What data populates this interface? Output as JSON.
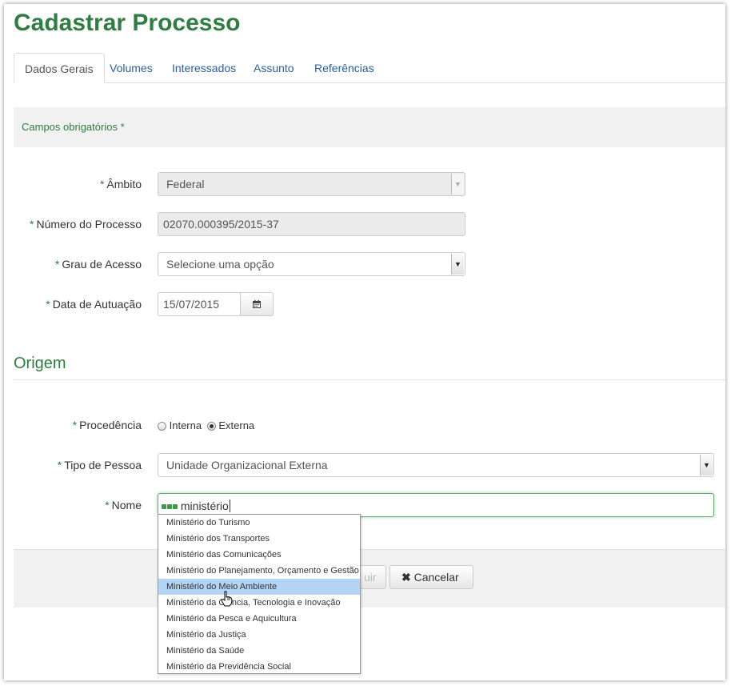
{
  "page_title": "Cadastrar Processo",
  "tabs": [
    {
      "label": "Dados Gerais"
    },
    {
      "label": "Volumes"
    },
    {
      "label": "Interessados"
    },
    {
      "label": "Assunto"
    },
    {
      "label": "Referências"
    }
  ],
  "required_note": "Campos obrigatórios",
  "required_mark": "*",
  "form": {
    "ambito": {
      "label": "Âmbito",
      "value": "Federal"
    },
    "numero": {
      "label": "Número do Processo",
      "value": "02070.000395/2015-37"
    },
    "grau": {
      "label": "Grau de Acesso",
      "value": "Selecione uma opção"
    },
    "data": {
      "label": "Data de Autuação",
      "value": "15/07/2015"
    }
  },
  "origem": {
    "title": "Origem",
    "procedencia": {
      "label": "Procedência",
      "option1": "Interna",
      "option2": "Externa",
      "selected": "Externa"
    },
    "tipo": {
      "label": "Tipo de Pessoa",
      "value": "Unidade Organizacional Externa"
    },
    "nome": {
      "label": "Nome",
      "value": "ministério"
    }
  },
  "buttons": {
    "incluir_partial": "uir",
    "cancelar": "Cancelar"
  },
  "autocomplete": [
    "Ministério do Turismo",
    "Ministério dos Transportes",
    "Ministério das Comunicações",
    "Ministério do Planejamento, Orçamento e Gestão",
    "Ministério do Meio Ambiente",
    "Ministério da Ciência, Tecnologia e Inovação",
    "Ministério da Pesca e Aquicultura",
    "Ministério da Justiça",
    "Ministério da Saúde",
    "Ministério da Previdência Social"
  ],
  "colors": {
    "accent": "#2e7d42",
    "link": "#2b5f9e",
    "highlight": "#b3d4f5"
  }
}
